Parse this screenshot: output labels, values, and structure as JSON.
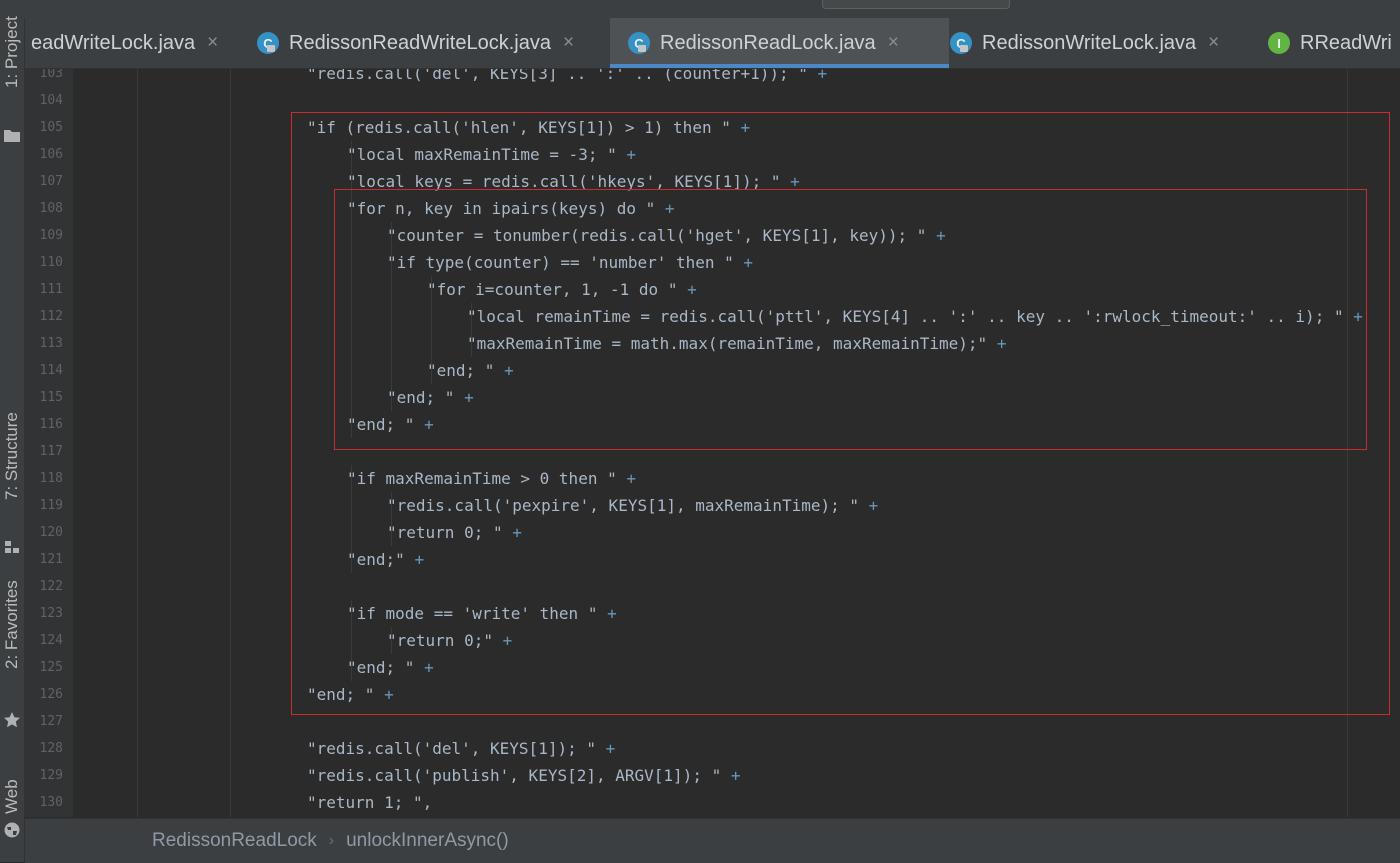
{
  "tool_windows": [
    {
      "label": "1: Project",
      "icon": "folder-icon"
    },
    {
      "label": "7: Structure",
      "icon": "structure-icon"
    },
    {
      "label": "2: Favorites",
      "icon": "star-icon"
    },
    {
      "label": "Web",
      "icon": "globe-icon"
    }
  ],
  "tabs": [
    {
      "label": "eadWriteLock.java",
      "icon_letter": "",
      "active": false
    },
    {
      "label": "RedissonReadWriteLock.java",
      "icon_letter": "C",
      "active": false
    },
    {
      "label": "RedissonReadLock.java",
      "icon_letter": "C",
      "active": true
    },
    {
      "label": "RedissonWriteLock.java",
      "icon_letter": "C",
      "active": false
    },
    {
      "label": "RReadWri",
      "icon_letter": "I",
      "active": false
    }
  ],
  "tab_close_glyph": "×",
  "code_lines": [
    {
      "num": "103",
      "indent": 0,
      "text": "\"redis.call('del', KEYS[3] .. ':' .. (counter+1)); \"",
      "plus": "+"
    },
    {
      "num": "104",
      "indent": 0,
      "text": "",
      "plus": ""
    },
    {
      "num": "105",
      "indent": 0,
      "text": "\"if (redis.call('hlen', KEYS[1]) > 1) then \"",
      "plus": "+"
    },
    {
      "num": "106",
      "indent": 1,
      "text": "\"local maxRemainTime = -3; \"",
      "plus": "+"
    },
    {
      "num": "107",
      "indent": 1,
      "text": "\"local keys = redis.call('hkeys', KEYS[1]); \"",
      "plus": "+"
    },
    {
      "num": "108",
      "indent": 1,
      "text": "\"for n, key in ipairs(keys) do \"",
      "plus": "+"
    },
    {
      "num": "109",
      "indent": 2,
      "text": "\"counter = tonumber(redis.call('hget', KEYS[1], key)); \"",
      "plus": "+"
    },
    {
      "num": "110",
      "indent": 2,
      "text": "\"if type(counter) == 'number' then \"",
      "plus": "+"
    },
    {
      "num": "111",
      "indent": 3,
      "text": "\"for i=counter, 1, -1 do \"",
      "plus": "+"
    },
    {
      "num": "112",
      "indent": 4,
      "text": "\"local remainTime = redis.call('pttl', KEYS[4] .. ':' .. key .. ':rwlock_timeout:' .. i); \"",
      "plus": "+"
    },
    {
      "num": "113",
      "indent": 4,
      "text": "\"maxRemainTime = math.max(remainTime, maxRemainTime);\"",
      "plus": "+"
    },
    {
      "num": "114",
      "indent": 3,
      "text": "\"end; \"",
      "plus": "+"
    },
    {
      "num": "115",
      "indent": 2,
      "text": "\"end; \"",
      "plus": "+"
    },
    {
      "num": "116",
      "indent": 1,
      "text": "\"end; \"",
      "plus": "+"
    },
    {
      "num": "117",
      "indent": 0,
      "text": "",
      "plus": ""
    },
    {
      "num": "118",
      "indent": 1,
      "text": "\"if maxRemainTime > 0 then \"",
      "plus": "+"
    },
    {
      "num": "119",
      "indent": 2,
      "text": "\"redis.call('pexpire', KEYS[1], maxRemainTime); \"",
      "plus": "+"
    },
    {
      "num": "120",
      "indent": 2,
      "text": "\"return 0; \"",
      "plus": "+"
    },
    {
      "num": "121",
      "indent": 1,
      "text": "\"end;\"",
      "plus": "+"
    },
    {
      "num": "122",
      "indent": 0,
      "text": "",
      "plus": ""
    },
    {
      "num": "123",
      "indent": 1,
      "text": "\"if mode == 'write' then \"",
      "plus": "+"
    },
    {
      "num": "124",
      "indent": 2,
      "text": "\"return 0;\"",
      "plus": "+"
    },
    {
      "num": "125",
      "indent": 1,
      "text": "\"end; \"",
      "plus": "+"
    },
    {
      "num": "126",
      "indent": 0,
      "text": "\"end; \"",
      "plus": "+"
    },
    {
      "num": "127",
      "indent": 0,
      "text": "",
      "plus": ""
    },
    {
      "num": "128",
      "indent": 0,
      "text": "\"redis.call('del', KEYS[1]); \"",
      "plus": "+"
    },
    {
      "num": "129",
      "indent": 0,
      "text": "\"redis.call('publish', KEYS[2], ARGV[1]); \"",
      "plus": "+"
    },
    {
      "num": "130",
      "indent": 0,
      "text": "\"return 1; \",",
      "plus": ""
    }
  ],
  "breadcrumb": {
    "class_name": "RedissonReadLock",
    "separator": "›",
    "method_name": "unlockInnerAsync()"
  },
  "colors": {
    "editor_bg": "#2b2b2b",
    "string": "#a9b7c6",
    "operator": "#6897bb",
    "highlight_box": "#cc2b2b",
    "active_tab_underline": "#4a88c7"
  }
}
